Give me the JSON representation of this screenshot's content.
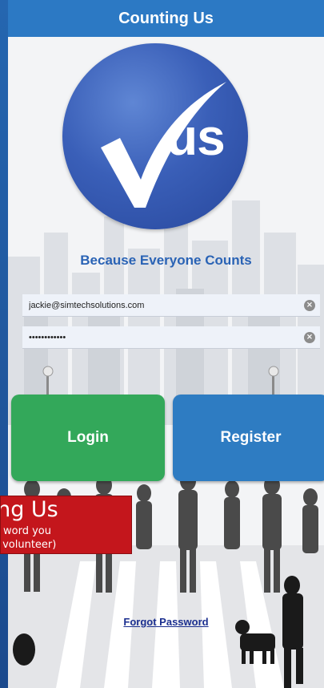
{
  "app": {
    "title": "Counting Us",
    "tagline": "Because Everyone Counts"
  },
  "logo": {
    "text": "us"
  },
  "login_form": {
    "email_value": "jackie@simtechsolutions.com",
    "password_value": "••••••••••••",
    "clear_glyph": "⨯"
  },
  "buttons": {
    "login_label": "Login",
    "register_label": "Register"
  },
  "links": {
    "forgot_password": "Forgot Password"
  },
  "callout": {
    "title": "ting Us",
    "line1": "word you",
    "line2": "a volunteer)"
  },
  "colors": {
    "header": "#2c79c4",
    "login_button": "#33a85a",
    "register_button": "#2e7cc2",
    "callout": "#c4161c",
    "tagline": "#2a63b5"
  }
}
